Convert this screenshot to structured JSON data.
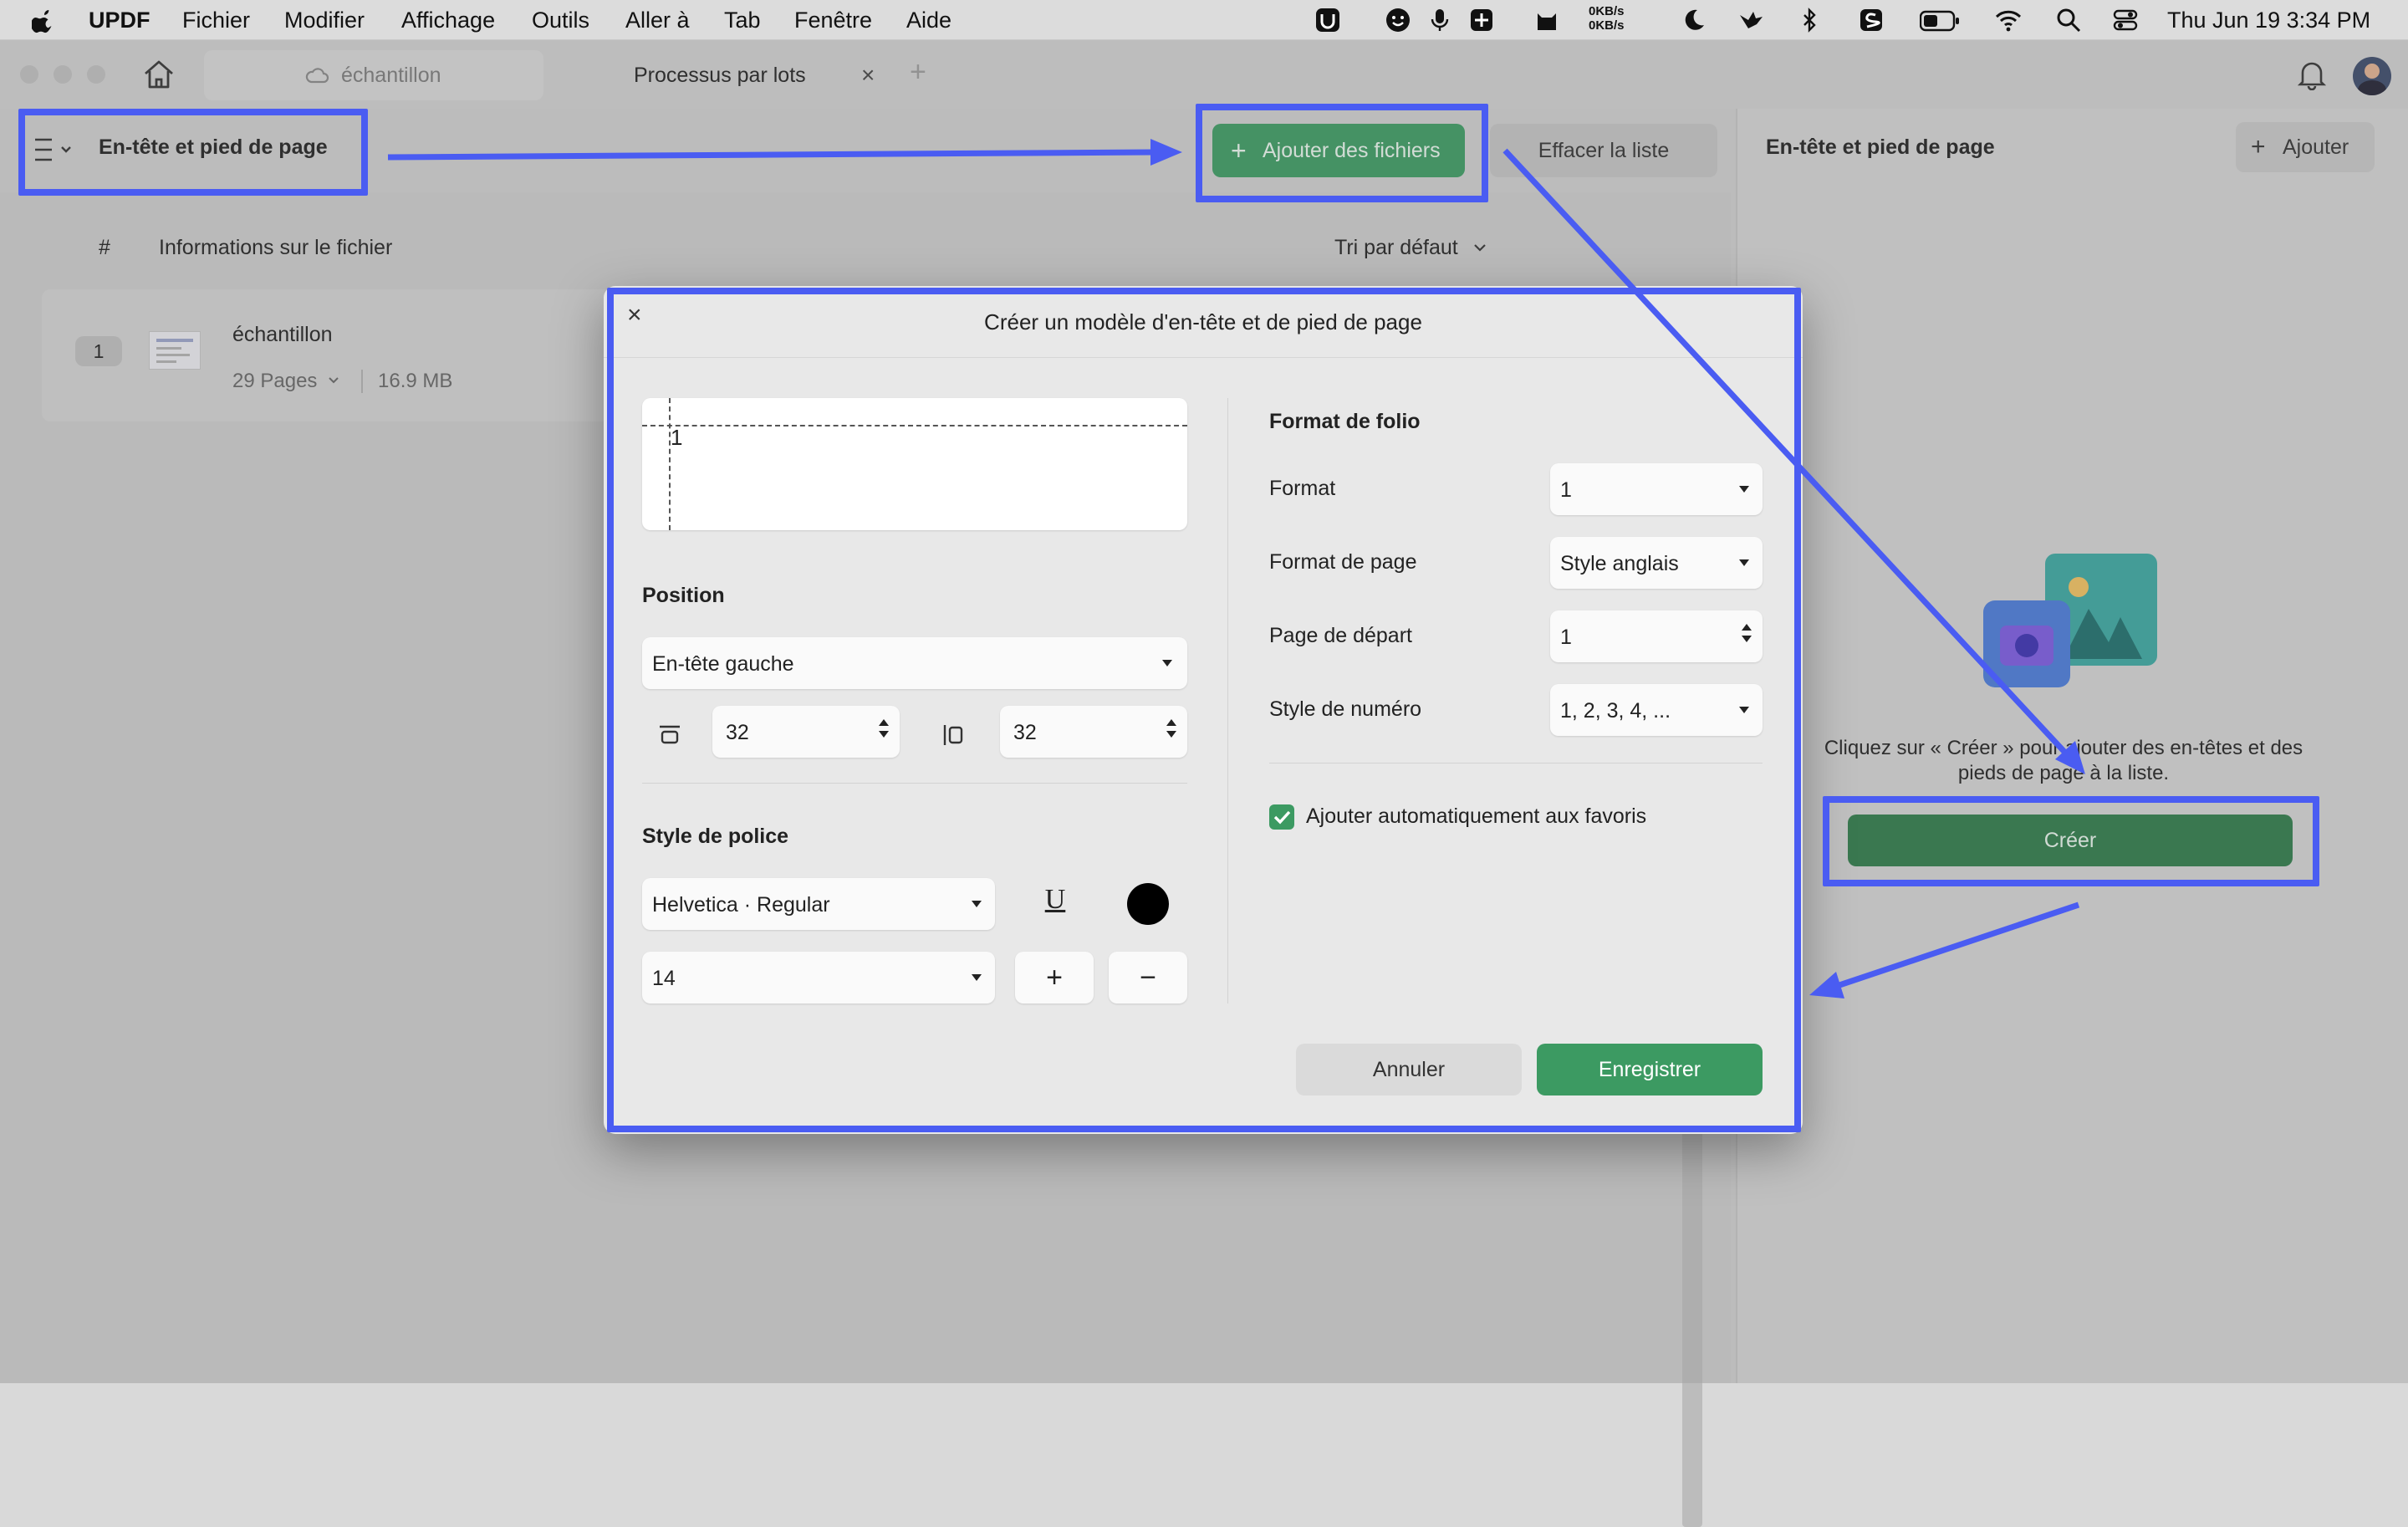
{
  "menubar": {
    "app_name": "UPDF",
    "items": [
      "Fichier",
      "Modifier",
      "Affichage",
      "Outils",
      "Aller à",
      "Tab",
      "Fenêtre",
      "Aide"
    ],
    "net_up": "0KB/s",
    "net_down": "0KB/s",
    "clock": "Thu Jun 19  3:34 PM"
  },
  "tabs": {
    "doc_tab": "échantillon",
    "active_tab": "Processus par lots"
  },
  "toolbar": {
    "title": "En-tête et pied de page",
    "add_files": "Ajouter des fichiers",
    "clear_list": "Effacer la liste"
  },
  "file_list": {
    "col_index": "#",
    "col_info": "Informations sur le fichier",
    "sort": "Tri par défaut",
    "rows": [
      {
        "index": "1",
        "name": "échantillon",
        "pages": "29 Pages",
        "size": "16.9 MB"
      }
    ]
  },
  "right_panel": {
    "title": "En-tête et pied de page",
    "add_button": "Ajouter",
    "hint": "Cliquez sur « Créer » pour ajouter des en-têtes et des pieds de page à la liste.",
    "create_button": "Créer"
  },
  "dialog": {
    "title": "Créer un modèle d'en-tête et de pied de page",
    "preview_number": "1",
    "position_label": "Position",
    "position_value": "En-tête gauche",
    "margin_top": "32",
    "margin_side": "32",
    "font_style_label": "Style de police",
    "font_value": "Helvetica · Regular",
    "font_size": "14",
    "underline_glyph": "U",
    "plus_glyph": "+",
    "minus_glyph": "−",
    "folio_label": "Format de folio",
    "format_label": "Format",
    "format_value": "1",
    "page_format_label": "Format de page",
    "page_format_value": "Style anglais",
    "start_page_label": "Page de départ",
    "start_page_value": "1",
    "number_style_label": "Style de numéro",
    "number_style_value": "1, 2, 3, 4, ...",
    "favorites_label": "Ajouter automatiquement aux favoris",
    "favorites_checked": true,
    "cancel": "Annuler",
    "save": "Enregistrer",
    "close_glyph": "×"
  },
  "colors": {
    "accent_green": "#3c9a62",
    "dark_green": "#2f7a4a",
    "annotation_blue": "#4a5cf2",
    "checkbox_green": "#3c9a62"
  }
}
